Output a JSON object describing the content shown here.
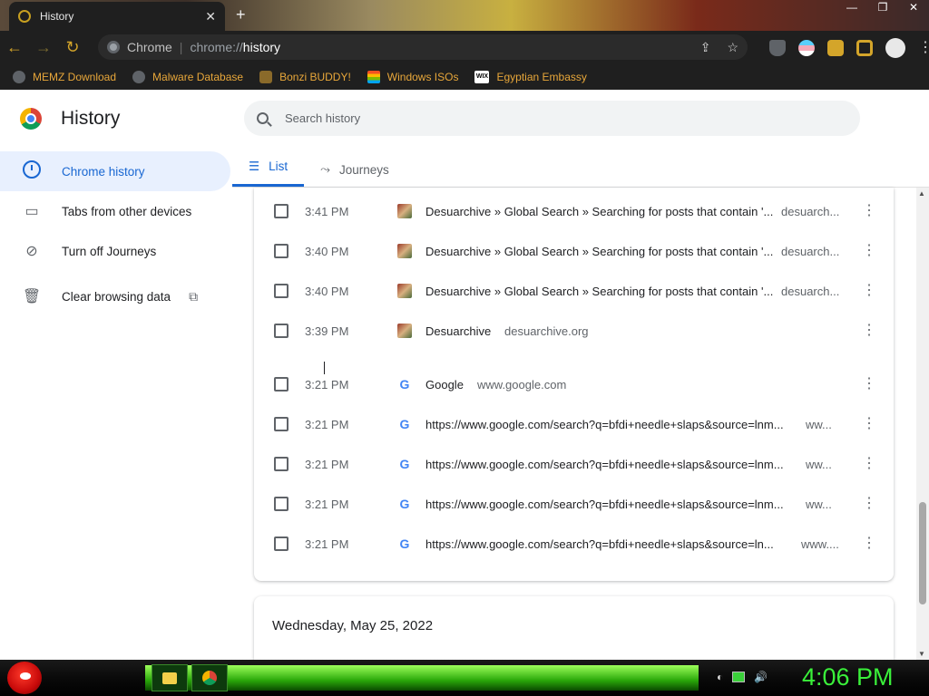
{
  "window": {
    "tab_title": "History",
    "close_glyph": "✕",
    "new_tab_glyph": "+",
    "controls": [
      "—",
      "❐",
      "✕"
    ]
  },
  "toolbar": {
    "back_glyph": "←",
    "forward_glyph": "→",
    "reload_glyph": "↻",
    "site_label": "Chrome",
    "url_prefix": "chrome://",
    "url_host": "history",
    "share_glyph": "⇪",
    "star_glyph": "☆",
    "menu_glyph": "⋮"
  },
  "bookmarks": [
    {
      "label": "MEMZ Download",
      "icon": "globe-icon"
    },
    {
      "label": "Malware Database",
      "icon": "globe-icon"
    },
    {
      "label": "Bonzi BUDDY!",
      "icon": "bonzi-icon"
    },
    {
      "label": "Windows ISOs",
      "icon": "windows-icon"
    },
    {
      "label": "Egyptian Embassy",
      "icon": "wix-icon"
    }
  ],
  "page": {
    "title": "History",
    "search_placeholder": "Search history"
  },
  "sidebar": {
    "items": [
      {
        "label": "Chrome history",
        "icon": "clock-icon",
        "active": true
      },
      {
        "label": "Tabs from other devices",
        "icon": "devices-icon"
      },
      {
        "label": "Turn off Journeys",
        "icon": "journeys-off-icon"
      },
      {
        "label": "Clear browsing data",
        "icon": "trash-icon",
        "ext_glyph": "⧉"
      }
    ]
  },
  "tabs": [
    {
      "label": "List",
      "glyph": "☰"
    },
    {
      "label": "Journeys",
      "glyph": "⤳"
    }
  ],
  "history": [
    {
      "time": "3:41 PM",
      "icon": "desuarchive-icon",
      "title": "Desuarchive » Global Search » Searching for posts that contain '...",
      "domain": "desuarch..."
    },
    {
      "time": "3:40 PM",
      "icon": "desuarchive-icon",
      "title": "Desuarchive » Global Search » Searching for posts that contain '...",
      "domain": "desuarch..."
    },
    {
      "time": "3:40 PM",
      "icon": "desuarchive-icon",
      "title": "Desuarchive » Global Search » Searching for posts that contain '...",
      "domain": "desuarch..."
    },
    {
      "time": "3:39 PM",
      "icon": "desuarchive-icon",
      "title": "Desuarchive",
      "domain": "desuarchive.org"
    },
    {
      "time": "3:21 PM",
      "icon": "google-icon",
      "title": "Google",
      "domain": "www.google.com"
    },
    {
      "time": "3:21 PM",
      "icon": "google-icon",
      "title": "https://www.google.com/search?q=bfdi+needle+slaps&source=lnm...",
      "domain": "ww..."
    },
    {
      "time": "3:21 PM",
      "icon": "google-icon",
      "title": "https://www.google.com/search?q=bfdi+needle+slaps&source=lnm...",
      "domain": "ww..."
    },
    {
      "time": "3:21 PM",
      "icon": "google-icon",
      "title": "https://www.google.com/search?q=bfdi+needle+slaps&source=lnm...",
      "domain": "ww..."
    },
    {
      "time": "3:21 PM",
      "icon": "google-icon",
      "title": "https://www.google.com/search?q=bfdi+needle+slaps&source=ln...",
      "domain": "www...."
    }
  ],
  "date_header": "Wednesday, May 25, 2022",
  "more_glyph": "⋮",
  "google_glyph": "G",
  "taskbar": {
    "clock": "4:06 PM",
    "volume_glyph": "🔊"
  },
  "colors": {
    "accent": "#1967d2",
    "active_bg": "#e8f0fe",
    "bookmark_text": "#e8a73a",
    "taskbar_clock": "#3af03a"
  }
}
